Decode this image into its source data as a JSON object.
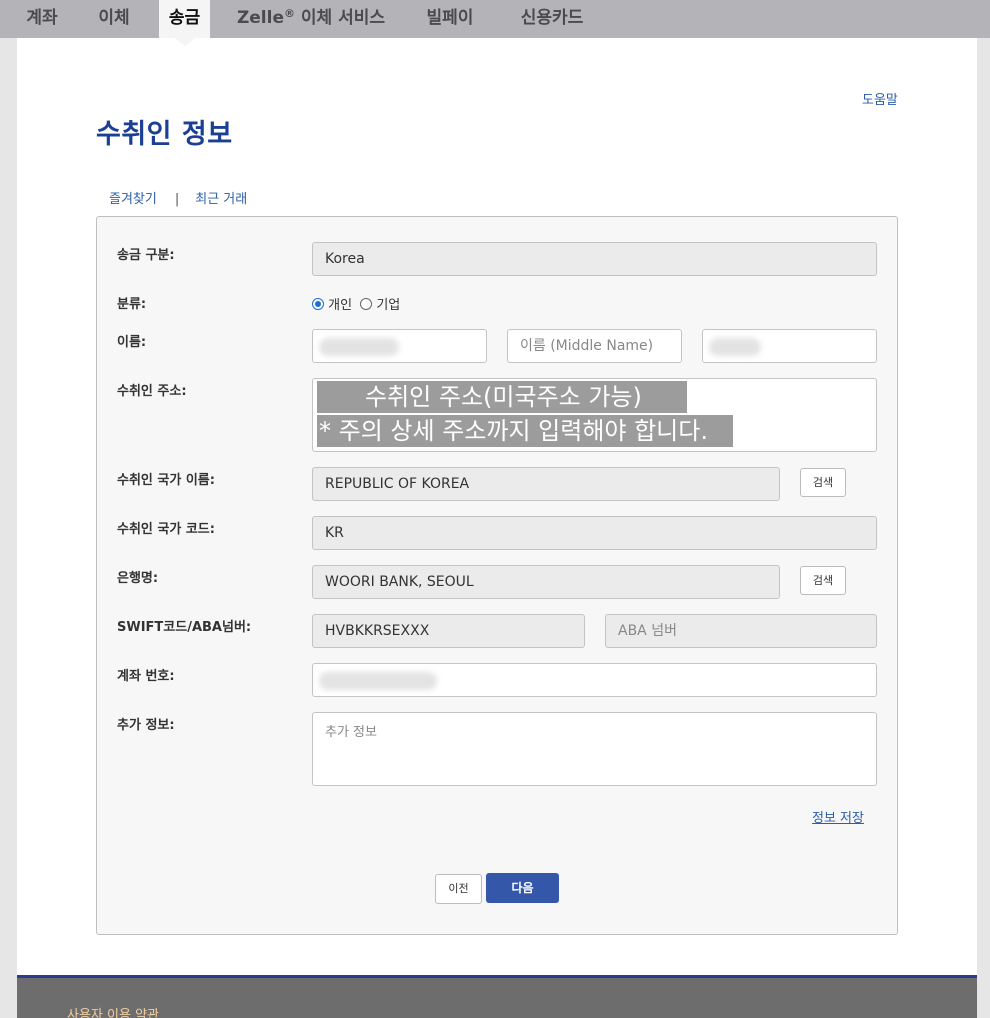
{
  "nav": {
    "tabs": [
      {
        "label": "계좌"
      },
      {
        "label": "이체"
      },
      {
        "label": "송금"
      },
      {
        "label": "Zelle",
        "sup": "®",
        "suffix": " 이체 서비스"
      },
      {
        "label": "빌페이"
      },
      {
        "label": "신용카드"
      }
    ],
    "active_index": 2
  },
  "header": {
    "help": "도움말",
    "title": "수취인 정보"
  },
  "subtabs": {
    "favorites": "즐겨찾기",
    "separator": "|",
    "recent": "최근 거래"
  },
  "form": {
    "transfer_type_label": "송금 구분:",
    "transfer_type_value": "Korea",
    "category_label": "분류:",
    "category_options": [
      "개인",
      "기업"
    ],
    "category_selected": "개인",
    "name_label": "이름:",
    "middle_name_placeholder": "이름 (Middle Name)",
    "address_label": "수취인 주소:",
    "address_placeholder_line1": "수취인 주소(미국주소 가능)",
    "address_placeholder_line2": "* 주의 상세 주소까지 입력해야 합니다.",
    "country_name_label": "수취인 국가 이름:",
    "country_name_value": "REPUBLIC OF KOREA",
    "country_code_label": "수취인 국가 코드:",
    "country_code_value": "KR",
    "bank_label": "은행명:",
    "bank_value": "WOORI BANK, SEOUL",
    "swift_label": "SWIFT코드/ABA넘버:",
    "swift_value": "HVBKKRSEXXX",
    "aba_placeholder": "ABA 넘버",
    "account_label": "계좌 번호:",
    "extra_label": "추가 정보:",
    "extra_placeholder": "추가 정보",
    "search_button": "검색",
    "save_info": "정보 저장",
    "prev_button": "이전",
    "next_button": "다음"
  },
  "footer": {
    "terms": "사용자 이용 약관"
  },
  "colors": {
    "title": "#1a3f93",
    "link": "#2a5ea8",
    "primary_button": "#3457a9",
    "footer_border": "#293c8e",
    "footer_link": "#f2cfa0"
  }
}
